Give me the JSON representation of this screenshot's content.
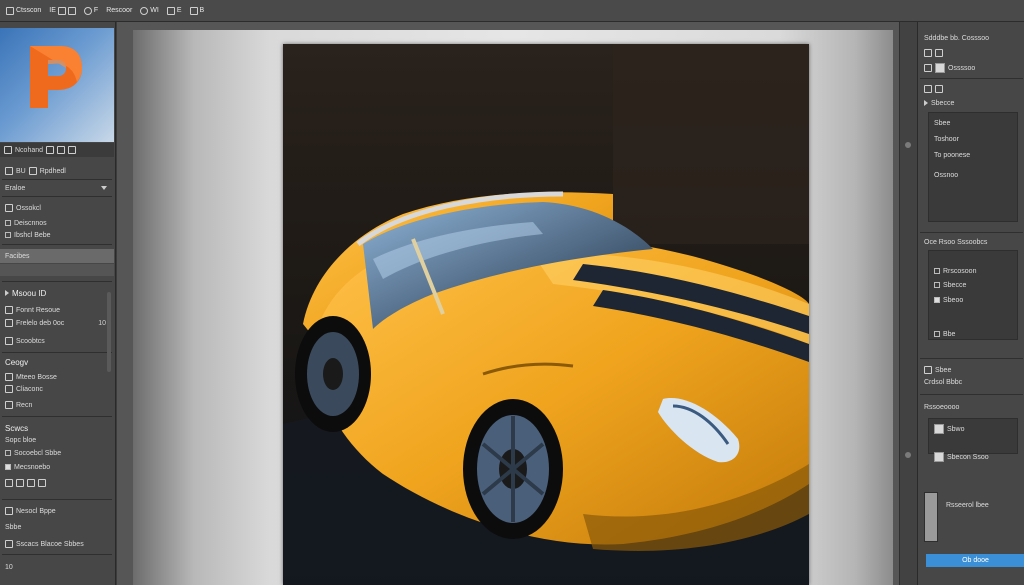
{
  "menubar": {
    "app_name": "Ctsscon",
    "items": [
      "IE",
      "F",
      "Rescoor",
      "WI",
      "E",
      "B"
    ]
  },
  "left_panel": {
    "logo_letter": "P",
    "logo_bar_label": "Ncohand",
    "tabs": [
      "BU",
      "Rpdhedl"
    ],
    "rows": [
      {
        "label": "Eraloe",
        "type": "row"
      },
      {
        "label": "Ossokcl",
        "type": "row"
      },
      {
        "label": "Deiscnnos",
        "type": "row"
      },
      {
        "label": "Ibshcl Bebe",
        "type": "row"
      },
      {
        "label": "Facibes",
        "type": "selected"
      },
      {
        "label": "Msoou ID",
        "type": "row"
      },
      {
        "label": "Fonnt Resoue",
        "type": "row"
      },
      {
        "label": "Frelelo deb 0oc",
        "type": "row"
      },
      {
        "label": "Scoobtcs",
        "type": "row"
      },
      {
        "label": "Ceogv",
        "type": "header"
      },
      {
        "label": "Mteeo Bosse",
        "type": "row"
      },
      {
        "label": "Cliaconc",
        "type": "row"
      },
      {
        "label": "Recn",
        "type": "row"
      },
      {
        "label": "Scwcs",
        "type": "header"
      },
      {
        "label": "Sopc bloe",
        "type": "row"
      },
      {
        "label": "Socoebcl Sbbe",
        "type": "row"
      },
      {
        "label": "Mecsnoebo",
        "type": "row"
      },
      {
        "label": "Nesocl Bppe",
        "type": "row"
      },
      {
        "label": "Sbbe",
        "type": "row"
      },
      {
        "label": "Sscacs Blacoe Sbbes",
        "type": "row"
      }
    ],
    "numbers": [
      "10",
      "10"
    ]
  },
  "right_panel": {
    "header": "Sdddbe bb. Cosssoo",
    "rows": [
      "Ossssoo",
      "Sbecce",
      "Sbee",
      "Toshoor",
      "To poonese",
      "Ossnoo",
      "Oce Rsoo Sssoobcs",
      "Rrscosoon",
      "Sbecce",
      "Sbeoo",
      "Bbe",
      "Sbee",
      "Crdsol Bbbc",
      "Rssoeoooo",
      "Sbwo",
      "Sbecon Ssoo",
      "Rsseerol lbee"
    ],
    "button_label": "Ob dooe",
    "accent": "#3b8fd6"
  },
  "canvas": {
    "car_color": "#f0a41e",
    "stripe_color": "#1e2633",
    "background": "#1c1814"
  }
}
